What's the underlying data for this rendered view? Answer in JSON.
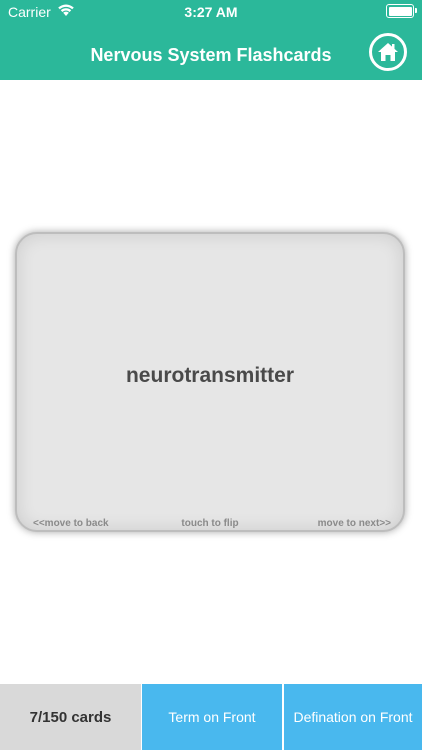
{
  "status_bar": {
    "carrier": "Carrier",
    "time": "3:27 AM",
    "wifi_icon": "wifi-icon",
    "battery_icon": "battery-icon"
  },
  "header": {
    "title": "Nervous System Flashcards",
    "home_icon": "home-icon",
    "background": "#2bb89a"
  },
  "card": {
    "term": "neurotransmitter",
    "hint_back": "<<move to back",
    "hint_flip": "touch to flip",
    "hint_next": "move to next>>"
  },
  "footer": {
    "count": "7/150 cards",
    "term_front": "Term on Front",
    "definition_front": "Defination on Front",
    "button_color": "#49b8ee"
  }
}
